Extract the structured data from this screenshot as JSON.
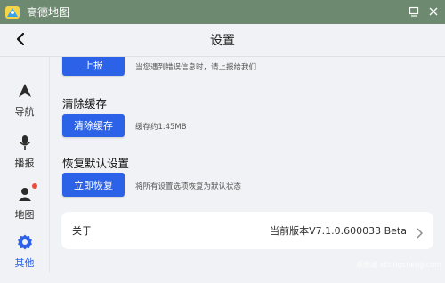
{
  "window": {
    "title": "高德地图"
  },
  "header": {
    "title": "设置"
  },
  "sidebar": {
    "items": [
      {
        "label": "导航",
        "active": false
      },
      {
        "label": "播报",
        "active": false
      },
      {
        "label": "地图",
        "active": false,
        "badge": true
      },
      {
        "label": "其他",
        "active": true
      }
    ]
  },
  "report": {
    "button": "上报",
    "desc": "当您遇到错误信息时，请上报给我们"
  },
  "cache": {
    "title": "清除缓存",
    "button": "清除缓存",
    "desc": "缓存约1.45MB"
  },
  "reset": {
    "title": "恢复默认设置",
    "button": "立即恢复",
    "desc": "将所有设置选项恢复为默认状态"
  },
  "about": {
    "label": "关于",
    "version": "当前版本V7.1.0.600033 Beta"
  },
  "watermark": "系统城 xitongcheng.com",
  "colors": {
    "accent": "#2c62e8",
    "titlebar": "#6d8a70",
    "badge": "#ee4b3a"
  }
}
